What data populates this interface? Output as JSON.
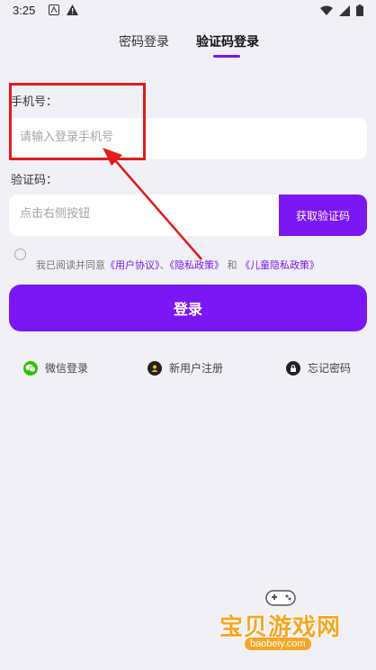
{
  "status": {
    "time": "3:25"
  },
  "tabs": {
    "password_login": "密码登录",
    "code_login": "验证码登录"
  },
  "form": {
    "phone_label": "手机号：",
    "phone_placeholder": "请输入登录手机号",
    "code_label": "验证码：",
    "code_placeholder": "点击右侧按钮",
    "get_code_button": "获取验证码"
  },
  "agreement": {
    "prefix": "我已阅读并同意",
    "user_agreement": "《用户协议》",
    "sep1": "、",
    "privacy_policy": "《隐私政策》",
    "and": "和",
    "children_privacy": "《儿童隐私政策》"
  },
  "login_button": "登录",
  "bottom_links": {
    "wechat": "微信登录",
    "register": "新用户注册",
    "forgot": "忘记密码"
  },
  "watermark": {
    "brand": "宝贝游戏网",
    "url": "baobeiy.com"
  },
  "colors": {
    "accent": "#7b16f5",
    "annotation": "#e21b1b",
    "watermark": "#f6a623"
  },
  "icons": [
    "wechat-icon",
    "user-icon",
    "lock-icon",
    "wifi-icon",
    "signal-icon",
    "battery-icon"
  ]
}
